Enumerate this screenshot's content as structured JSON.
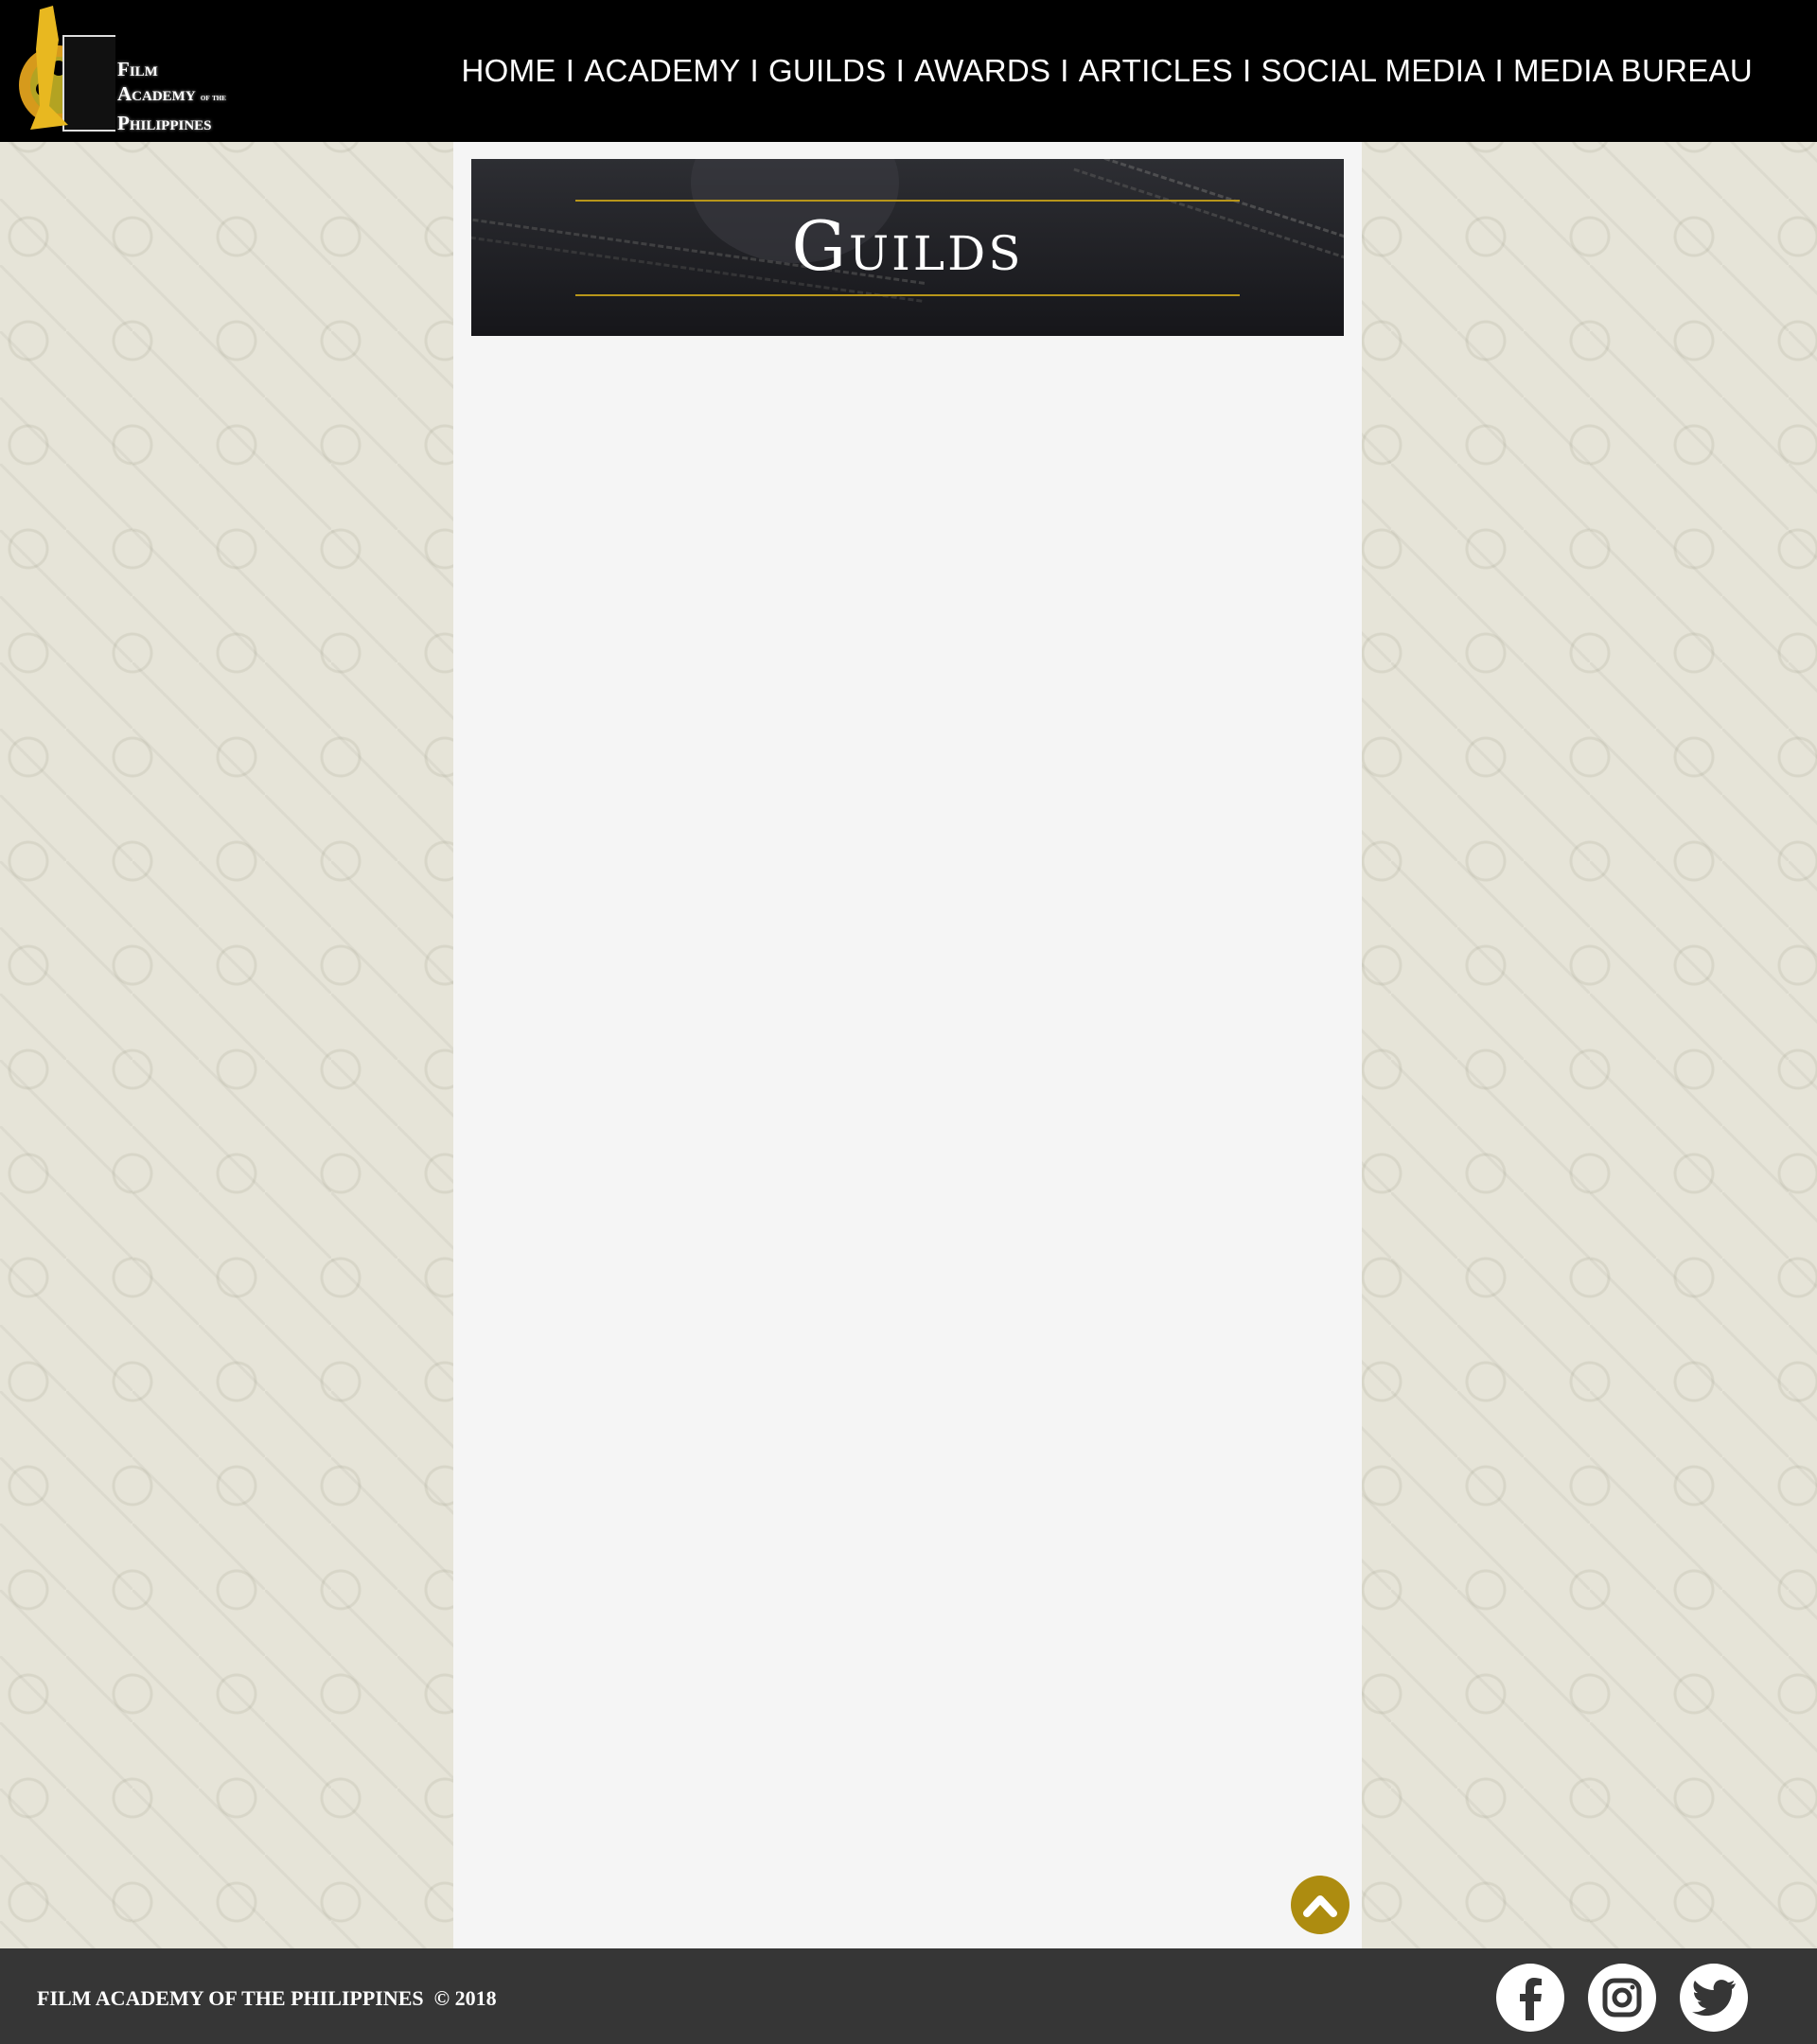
{
  "logo": {
    "line1": "Film",
    "line2": "Academy",
    "line2_small": "of the",
    "line3": "Philippines"
  },
  "nav": [
    {
      "label": "HOME"
    },
    {
      "label": "ACADEMY"
    },
    {
      "label": "GUILDS"
    },
    {
      "label": "AWARDS"
    },
    {
      "label": "ARTICLES"
    },
    {
      "label": "SOCIAL MEDIA"
    },
    {
      "label": "MEDIA BUREAU"
    }
  ],
  "nav_separator": "I",
  "banner": {
    "title": "Guilds"
  },
  "footer": {
    "org": "FILM ACADEMY OF THE PHILIPPINES",
    "copyright": "© 2018"
  },
  "colors": {
    "accent": "#ad8c10",
    "header": "#000000",
    "footer": "#363636"
  }
}
